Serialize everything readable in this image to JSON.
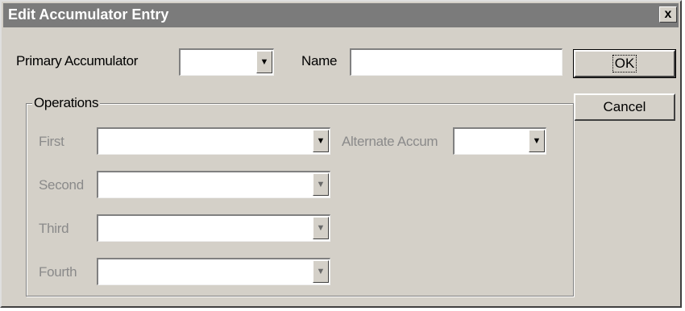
{
  "dialog": {
    "title": "Edit Accumulator Entry",
    "close_glyph": "x"
  },
  "primary_accumulator": {
    "label": "Primary Accumulator",
    "value": "",
    "dropdown_icon": "dropdown-arrow-icon"
  },
  "name": {
    "label": "Name",
    "value": ""
  },
  "operations": {
    "group_label": "Operations",
    "first": {
      "label": "First",
      "value": ""
    },
    "alternate_accum": {
      "label": "Alternate Accum",
      "value": ""
    },
    "second": {
      "label": "Second",
      "value": ""
    },
    "third": {
      "label": "Third",
      "value": ""
    },
    "fourth": {
      "label": "Fourth",
      "value": ""
    }
  },
  "buttons": {
    "ok": "OK",
    "cancel": "Cancel"
  },
  "colors": {
    "dialog_bg": "#d4d0c8",
    "titlebar_bg": "#7b7b7b",
    "disabled_text": "#8a8a8a"
  }
}
